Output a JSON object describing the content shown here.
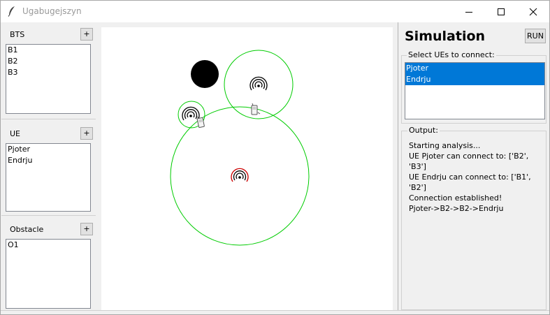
{
  "window": {
    "title": "Ugabugejszyn"
  },
  "left_panel": {
    "bts": {
      "label": "BTS",
      "add_label": "+",
      "items": [
        "B1",
        "B2",
        "B3"
      ]
    },
    "ue": {
      "label": "UE",
      "add_label": "+",
      "items": [
        "Pjoter",
        "Endrju"
      ]
    },
    "obstacle": {
      "label": "Obstacle",
      "add_label": "+",
      "items": [
        "O1"
      ]
    }
  },
  "simulation": {
    "title": "Simulation",
    "run_label": "RUN",
    "select_label": "Select UEs to connect:",
    "selected_ues": [
      "Pjoter",
      "Endrju"
    ],
    "output_label": "Output:",
    "output_lines": [
      "Starting analysis...",
      "UE Pjoter can connect to: ['B2', 'B3']",
      "UE Endrju can connect to: ['B1', 'B2']",
      "Connection established!",
      "Pjoter->B2->B2->Endrju"
    ]
  },
  "icons": {
    "app": "feather-icon",
    "bts": "antenna-signal-icon",
    "ue": "mobile-phone-icon"
  },
  "colors": {
    "coverage_ring": "#00cc00",
    "selection": "#0078d7",
    "obstacle": "#000000",
    "bts_highlight": "#cc0000"
  }
}
